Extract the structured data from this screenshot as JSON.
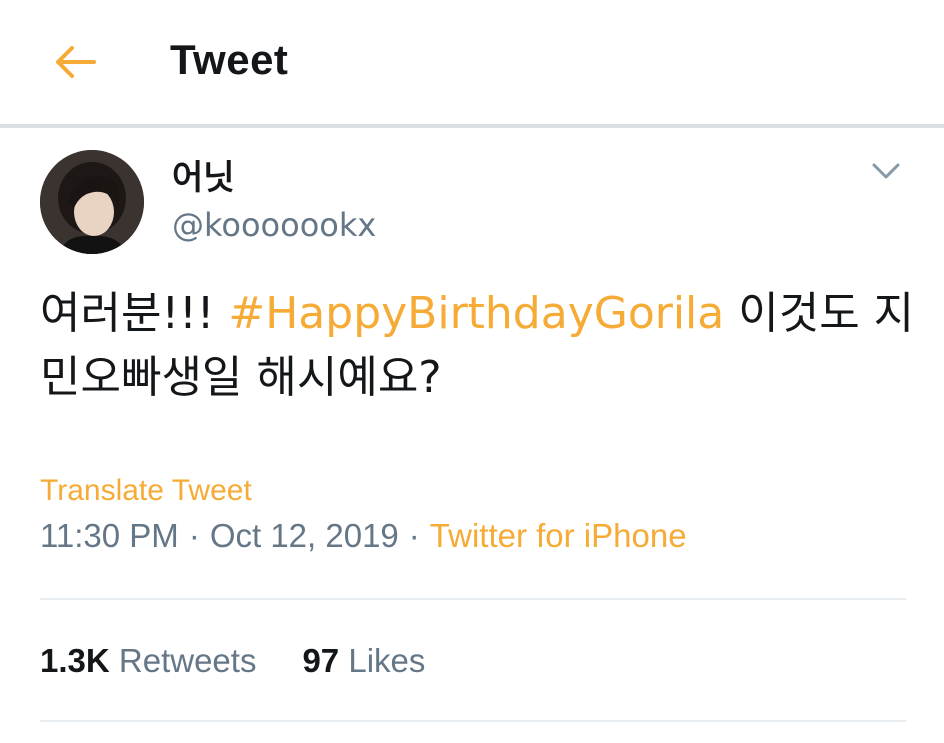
{
  "header": {
    "back_icon": "arrow-left-icon",
    "title": "Tweet"
  },
  "tweet": {
    "author": {
      "display_name": "어닛",
      "handle": "@kooooookx",
      "avatar": "profile-photo"
    },
    "menu_icon": "chevron-down-icon",
    "text_before": "여러분!!! ",
    "hashtag": "#HappyBirthdayGorila",
    "text_after": " 이것도 지민오빠생일 해시예요?",
    "translate_label": "Translate Tweet",
    "time": "11:30 PM",
    "date": "Oct 12, 2019",
    "separator": "·",
    "source": "Twitter for iPhone"
  },
  "stats": {
    "retweets_count": "1.3K",
    "retweets_label": "Retweets",
    "likes_count": "97",
    "likes_label": "Likes"
  },
  "colors": {
    "accent": "#f5ab35",
    "text": "#14171a",
    "muted": "#657786",
    "divider": "#e6ecf0"
  }
}
